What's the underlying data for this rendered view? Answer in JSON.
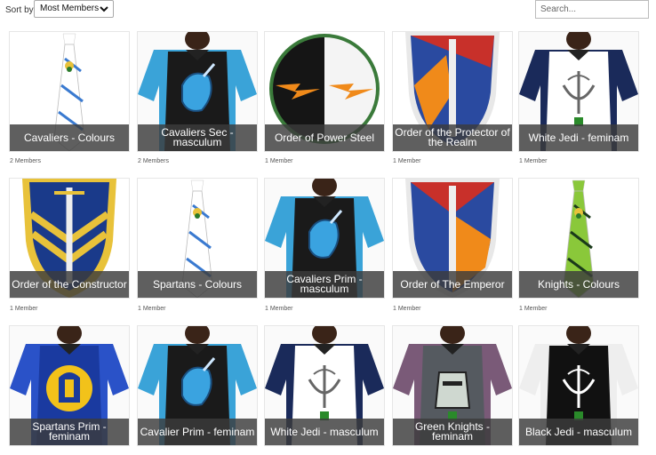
{
  "toolbar": {
    "sort_label": "Sort by",
    "sort_value": "Most Members",
    "search_placeholder": "Search..."
  },
  "groups": [
    {
      "name": "Cavaliers - Colours",
      "members": "2 Members",
      "art": "tie-white-blue"
    },
    {
      "name": "Cavaliers Sec - masculum",
      "members": "2 Members",
      "art": "jersey-blue-unicorn"
    },
    {
      "name": "Order of Power Steel",
      "members": "1 Member",
      "art": "patch-lightning"
    },
    {
      "name": "Order of the Protector of the Realm",
      "members": "1 Member",
      "art": "shield-red-blue-sword"
    },
    {
      "name": "White Jedi - feminam",
      "members": "1 Member",
      "art": "jersey-white-jedi"
    },
    {
      "name": "Order of the Constructor",
      "members": "1 Member",
      "art": "shield-blue-yellow-chevron"
    },
    {
      "name": "Spartans - Colours",
      "members": "1 Member",
      "art": "tie-white-blue"
    },
    {
      "name": "Cavaliers Prim - masculum",
      "members": "1 Member",
      "art": "jersey-blue-unicorn"
    },
    {
      "name": "Order of The Emperor",
      "members": "1 Member",
      "art": "shield-red-blue-orange"
    },
    {
      "name": "Knights - Colours",
      "members": "1 Member",
      "art": "tie-green"
    },
    {
      "name": "Spartans Prim - feminam",
      "members": "",
      "art": "jersey-blue-spartan"
    },
    {
      "name": "Cavalier Prim - feminam",
      "members": "",
      "art": "jersey-blue-unicorn"
    },
    {
      "name": "White Jedi - masculum",
      "members": "",
      "art": "jersey-white-jedi"
    },
    {
      "name": "Green Knights - feminam",
      "members": "",
      "art": "jersey-grey-knight"
    },
    {
      "name": "Black Jedi - masculum",
      "members": "",
      "art": "jersey-black-jedi"
    }
  ]
}
